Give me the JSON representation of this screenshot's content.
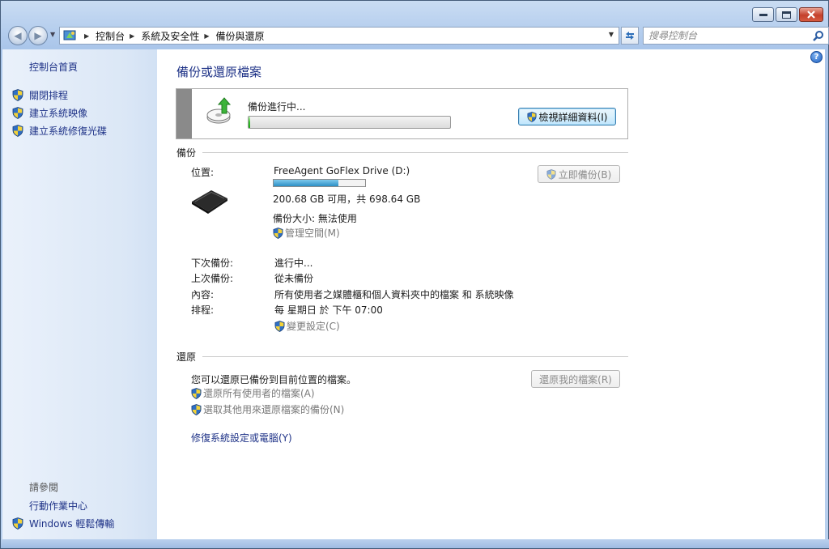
{
  "window": {
    "buttons": {
      "minimize": "minimize-icon",
      "maximize": "maximize-icon",
      "close": "close-icon"
    }
  },
  "address_bar": {
    "crumbs": [
      "控制台",
      "系統及安全性",
      "備份與還原"
    ]
  },
  "search": {
    "placeholder": "搜尋控制台"
  },
  "sidebar": {
    "home": "控制台首頁",
    "items": [
      {
        "label": "關閉排程"
      },
      {
        "label": "建立系統映像"
      },
      {
        "label": "建立系統修復光碟"
      }
    ],
    "see_also_title": "請參閱",
    "see_also": [
      {
        "label": "行動作業中心"
      },
      {
        "label": "Windows 輕鬆傳輸"
      }
    ]
  },
  "main": {
    "title": "備份或還原檔案",
    "progress": {
      "text": "備份進行中...",
      "fraction": 0.01,
      "details_button": "檢視詳細資料(I)"
    },
    "backup": {
      "section_title": "備份",
      "location_label": "位置:",
      "drive_name": "FreeAgent GoFlex Drive (D:)",
      "capacity_used_fraction": 0.71,
      "capacity_text": "200.68 GB 可用，共 698.64 GB",
      "backup_size": "備份大小: 無法使用",
      "manage_space": "管理空間(M)",
      "backup_now": "立即備份(B)",
      "rows": [
        {
          "label": "下次備份:",
          "value": "進行中..."
        },
        {
          "label": "上次備份:",
          "value": "從未備份"
        },
        {
          "label": "內容:",
          "value": "所有使用者之媒體櫃和個人資料夾中的檔案 和 系統映像"
        },
        {
          "label": "排程:",
          "value": "每 星期日 於 下午 07:00"
        }
      ],
      "change_settings": "變更設定(C)"
    },
    "restore": {
      "section_title": "還原",
      "description": "您可以還原已備份到目前位置的檔案。",
      "restore_my_files": "還原我的檔案(R)",
      "restore_all_users": "還原所有使用者的檔案(A)",
      "select_other_backup": "選取其他用來還原檔案的備份(N)",
      "recover_link": "修復系統設定或電腦(Y)"
    }
  }
}
